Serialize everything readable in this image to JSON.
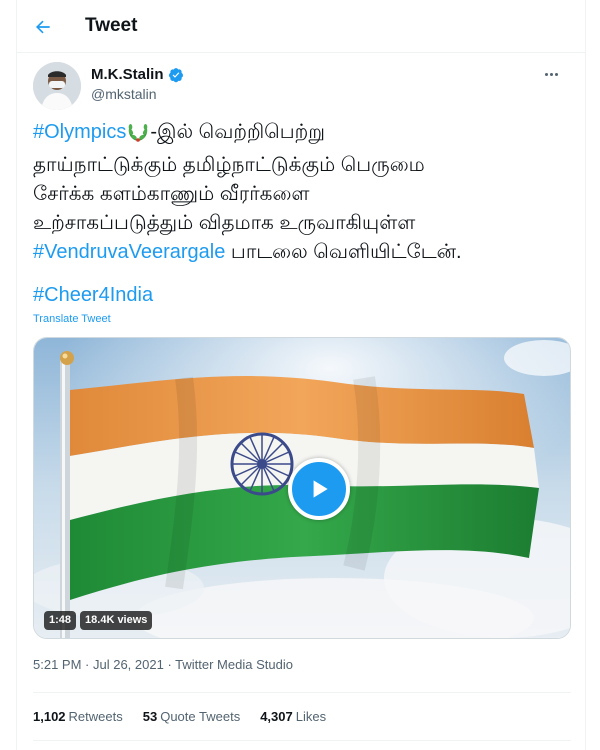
{
  "header": {
    "title": "Tweet",
    "back_icon": "arrow-left-icon"
  },
  "author": {
    "display_name": "M.K.Stalin",
    "handle": "@mkstalin",
    "verified_icon": "verified-badge-icon",
    "more_icon": "more-horizontal-icon"
  },
  "tweet": {
    "hashtag_olympics": "#Olympics",
    "laurel_icon": "laurel-wreath-emoji",
    "line1_rest": "-இல் வெற்றிபெற்று",
    "line2": "தாய்நாட்டுக்கும் தமிழ்நாட்டுக்கும் பெருமை",
    "line3": "சேர்க்க களம்காணும் வீரர்களை",
    "line4": "உற்சாகப்படுத்தும் விதமாக உருவாகியுள்ள",
    "hashtag_song": "#VendruvaVeerargale",
    "line5_rest": " பாடலை வெளியிட்டேன்.",
    "hashtag_cheer": "#Cheer4India",
    "translate_label": "Translate Tweet"
  },
  "media": {
    "duration": "1:48",
    "views": "18.4K views",
    "play_icon": "play-icon"
  },
  "meta": {
    "time": "5:21 PM",
    "separator": " · ",
    "date": "Jul 26, 2021",
    "source": "Twitter Media Studio"
  },
  "stats": {
    "retweets_count": "1,102",
    "retweets_label": "Retweets",
    "quotes_count": "53",
    "quotes_label": "Quote Tweets",
    "likes_count": "4,307",
    "likes_label": "Likes"
  },
  "colors": {
    "accent": "#1d9bf0",
    "text": "#0f1419",
    "secondary": "#536471",
    "saffron": "#f4a261",
    "green": "#2e9e44"
  }
}
